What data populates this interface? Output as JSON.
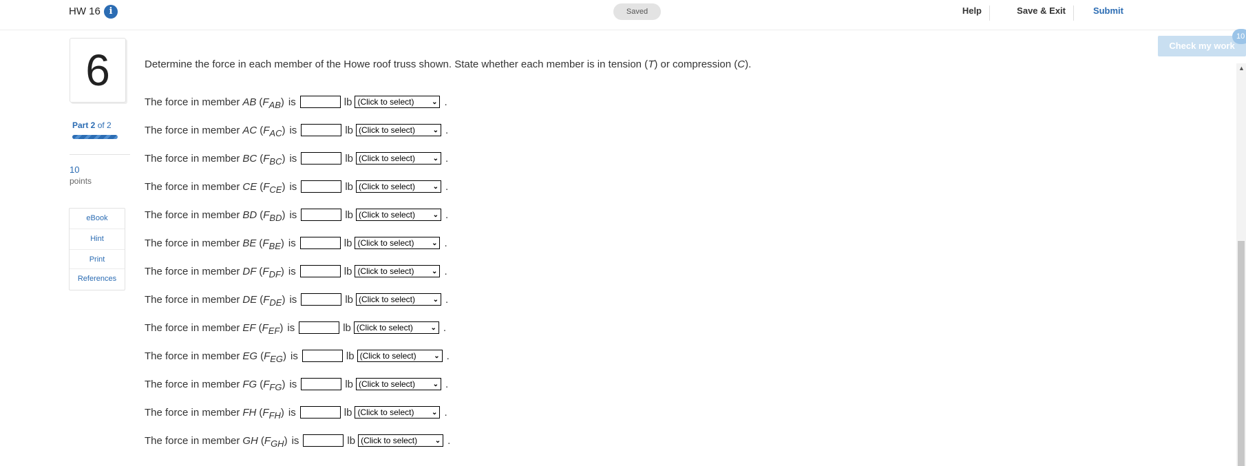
{
  "header": {
    "title": "HW 16",
    "info_icon": "info-icon",
    "saved": "Saved",
    "links": {
      "help": "Help",
      "save_exit": "Save & Exit",
      "submit": "Submit"
    }
  },
  "question": {
    "number": "6",
    "part": {
      "bold": "Part 2",
      "rest": "of 2"
    },
    "points_value": "10",
    "points_label": "points",
    "tools": [
      "eBook",
      "Hint",
      "Print",
      "References"
    ],
    "check_button": "Check my work",
    "check_badge": "10",
    "prompt_pre": "Determine the force in each member of the Howe roof truss shown. State whether each member is in tension (",
    "prompt_t": "T",
    "prompt_mid": ") or compression (",
    "prompt_c": "C",
    "prompt_post": ")."
  },
  "common": {
    "lead": "The force in member",
    "is": "is",
    "unit": "lb",
    "select_placeholder": "(Click to select)",
    "f_symbol": "F",
    "period": "."
  },
  "rows": [
    {
      "member": "AB",
      "sub": "AB"
    },
    {
      "member": "AC",
      "sub": "AC"
    },
    {
      "member": "BC",
      "sub": "BC"
    },
    {
      "member": "CE",
      "sub": "CE"
    },
    {
      "member": "BD",
      "sub": "BD"
    },
    {
      "member": "BE",
      "sub": "BE"
    },
    {
      "member": "DF",
      "sub": "DF"
    },
    {
      "member": "DE",
      "sub": "DE"
    },
    {
      "member": "EF",
      "sub": "EF"
    },
    {
      "member": "EG",
      "sub": "EG"
    },
    {
      "member": "FG",
      "sub": "FG"
    },
    {
      "member": "FH",
      "sub": "FH"
    },
    {
      "member": "GH",
      "sub": "GH"
    }
  ]
}
